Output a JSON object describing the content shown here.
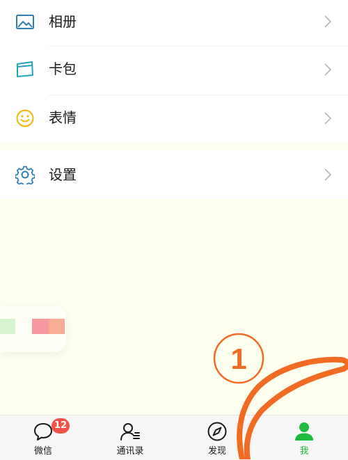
{
  "menu": {
    "items": [
      {
        "label": "相册",
        "icon": "photo-album-icon"
      },
      {
        "label": "卡包",
        "icon": "card-wallet-icon"
      },
      {
        "label": "表情",
        "icon": "smiley-face-icon"
      },
      {
        "label": "设置",
        "icon": "gear-icon"
      }
    ]
  },
  "annotation": {
    "number": "1",
    "color": "#f26b22"
  },
  "tabbar": {
    "tabs": [
      {
        "label": "微信",
        "badge": "12",
        "icon": "chat-bubble-icon"
      },
      {
        "label": "通讯录",
        "icon": "contacts-icon"
      },
      {
        "label": "发现",
        "icon": "compass-icon"
      },
      {
        "label": "我",
        "icon": "person-icon",
        "active": true
      }
    ],
    "accent_color": "#1fbb3f",
    "badge_color": "#f25349"
  },
  "colors": {
    "icon_blue": "#2f7fb6",
    "icon_yellow": "#f4b400",
    "background": "#fffff0"
  }
}
